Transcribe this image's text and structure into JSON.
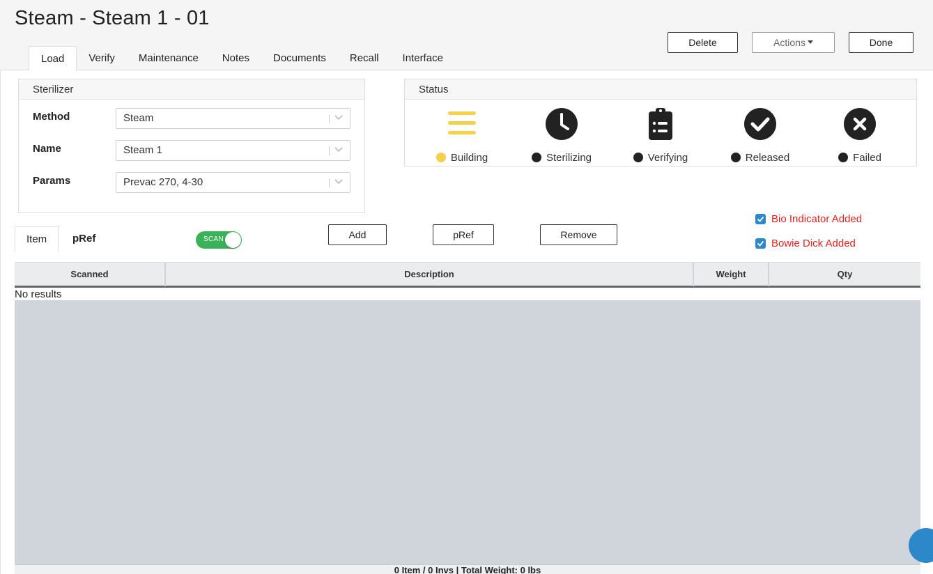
{
  "header": {
    "title": "Steam - Steam 1 - 01",
    "tabs": [
      {
        "label": "Load",
        "active": true
      },
      {
        "label": "Verify"
      },
      {
        "label": "Maintenance"
      },
      {
        "label": "Notes"
      },
      {
        "label": "Documents"
      },
      {
        "label": "Recall"
      },
      {
        "label": "Interface"
      }
    ],
    "buttons": {
      "delete": "Delete",
      "actions": "Actions",
      "done": "Done"
    }
  },
  "sterilizer": {
    "title": "Sterilizer",
    "fields": [
      {
        "label": "Method",
        "value": "Steam"
      },
      {
        "label": "Name",
        "value": "Steam 1"
      },
      {
        "label": "Params",
        "value": "Prevac 270, 4-30"
      }
    ]
  },
  "status": {
    "title": "Status",
    "steps": [
      {
        "label": "Building",
        "icon": "list-icon",
        "state": "current",
        "color": "#f5d04a"
      },
      {
        "label": "Sterilizing",
        "icon": "clock-icon",
        "state": "pending",
        "color": "#222222"
      },
      {
        "label": "Verifying",
        "icon": "clipboard-icon",
        "state": "pending",
        "color": "#222222"
      },
      {
        "label": "Released",
        "icon": "check-circle-icon",
        "state": "pending",
        "color": "#222222"
      },
      {
        "label": "Failed",
        "icon": "x-circle-icon",
        "state": "pending",
        "color": "#222222"
      }
    ]
  },
  "items": {
    "subtabs": [
      {
        "label": "Item",
        "active": true
      },
      {
        "label": "pRef"
      }
    ],
    "scan_toggle": {
      "label": "SCAN",
      "on": true
    },
    "buttons": {
      "add": "Add",
      "pref": "pRef",
      "remove": "Remove"
    },
    "checks": [
      {
        "label": "Bio Indicator Added",
        "checked": true
      },
      {
        "label": "Bowie Dick Added",
        "checked": true
      }
    ],
    "columns": [
      "Scanned",
      "Description",
      "Weight",
      "Qty"
    ],
    "empty_text": "No results",
    "footer": "0 Item / 0 Invs | Total Weight: 0 lbs"
  },
  "colors": {
    "accent": "#2d88c9",
    "toggle_on": "#3bb25a",
    "warning_text": "#e0231f",
    "building": "#f5d04a"
  }
}
